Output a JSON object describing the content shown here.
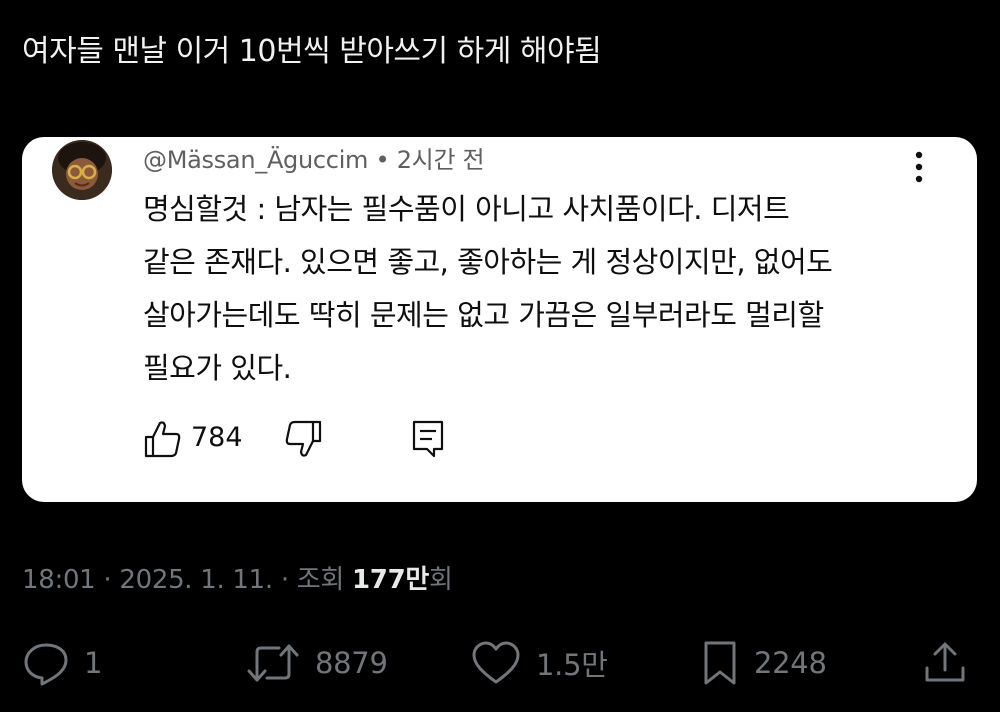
{
  "post": {
    "text": "여자들 맨날 이거 10번씩 받아쓰기 하게 해야됨"
  },
  "comment": {
    "author": "@Mässan_Äguccim",
    "separator": "•",
    "time": "2시간 전",
    "body_lines": [
      "명심할것 : 남자는 필수품이 아니고 사치품이다. 디저트",
      "같은 존재다. 있으면 좋고, 좋아하는 게 정상이지만, 없어도",
      "살아가는데도 딱히 문제는 없고 가끔은 일부러라도 멀리할",
      "필요가 있다."
    ],
    "like_count": "784",
    "icons": {
      "avatar": "avatar",
      "more": "more-vertical-icon",
      "like": "thumbs-up-icon",
      "dislike": "thumbs-down-icon",
      "reply": "reply-comment-icon"
    }
  },
  "meta": {
    "time": "18:01",
    "dot1": "·",
    "date": "2025. 1. 11.",
    "dot2": "·",
    "views_prefix": "조회",
    "views_count": "177만",
    "views_suffix": "회"
  },
  "engagement": {
    "replies": "1",
    "retweets": "8879",
    "likes": "1.5만",
    "bookmarks": "2248",
    "icons": {
      "reply": "reply-icon",
      "retweet": "retweet-icon",
      "like": "heart-icon",
      "bookmark": "bookmark-icon",
      "share": "share-icon"
    }
  },
  "colors": {
    "background": "#000000",
    "card": "#ffffff",
    "muted": "#71767b",
    "text_light": "#e7e9ea"
  }
}
